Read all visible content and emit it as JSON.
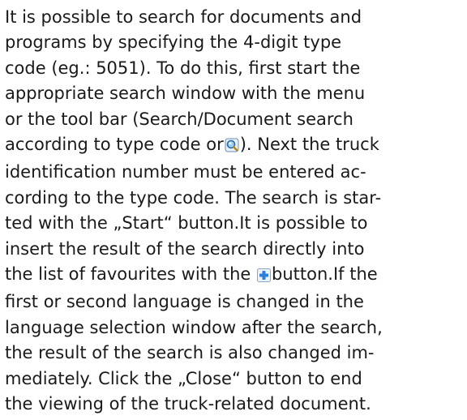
{
  "help": {
    "lines": [
      "It is possible to search for documents and",
      "programs by specifying the 4-digit type",
      "code (eg.: 5051). To do this, first start the",
      "appropriate search window with the menu",
      "or the tool bar (Search/Document search",
      "according to type code or",
      "). Next the truck",
      "identification number must be entered ac-",
      "cording to the type code. The search is star-",
      "ted with the „Start“ button.It is possible to",
      "insert the result of the search directly into",
      "the list of favourites with the",
      "button.If the",
      "first or second language is changed in the",
      "language selection window after the search,",
      "the result of the search is also changed im-",
      "mediately. Click the „Close“ button to end",
      "the viewing of the truck-related document."
    ]
  },
  "icons": {
    "search": "document-search-icon",
    "add_favourite": "add-to-favourites-icon"
  },
  "colors": {
    "text": "#1a1a1a",
    "search_icon": "#3a7fc8",
    "favourite_icon": "#2f7fd6"
  }
}
